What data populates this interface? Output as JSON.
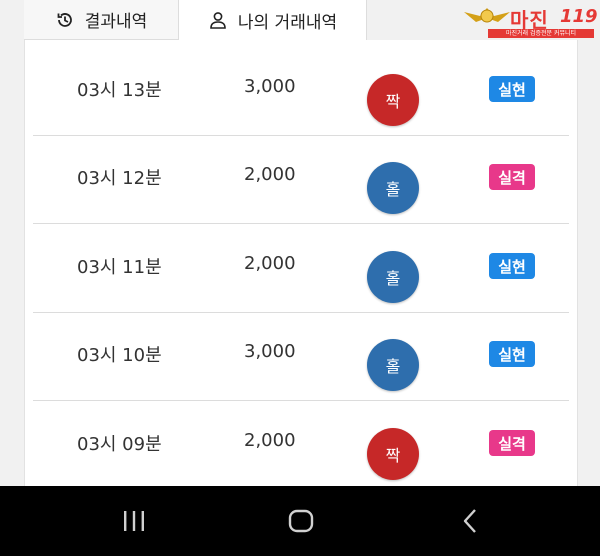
{
  "tabs": [
    {
      "label": "결과내역",
      "icon": "history-icon",
      "active": false
    },
    {
      "label": "나의 거래내역",
      "icon": "user-icon",
      "active": true
    }
  ],
  "logo": {
    "text": "마진",
    "number": "119",
    "subtitle": "마진거래 검증전문 커뮤니티"
  },
  "colors": {
    "even_ball": "#c62828",
    "odd_ball": "#2e6ead",
    "hit_badge": "#1e88e5",
    "miss_badge": "#e8388a"
  },
  "rows": [
    {
      "time": "03시 13분",
      "amount": "3,000",
      "pick": "짝",
      "pick_type": "even",
      "result": "실현",
      "result_type": "hit"
    },
    {
      "time": "03시 12분",
      "amount": "2,000",
      "pick": "홀",
      "pick_type": "odd",
      "result": "실격",
      "result_type": "miss"
    },
    {
      "time": "03시 11분",
      "amount": "2,000",
      "pick": "홀",
      "pick_type": "odd",
      "result": "실현",
      "result_type": "hit"
    },
    {
      "time": "03시 10분",
      "amount": "3,000",
      "pick": "홀",
      "pick_type": "odd",
      "result": "실현",
      "result_type": "hit"
    },
    {
      "time": "03시 09분",
      "amount": "2,000",
      "pick": "짝",
      "pick_type": "even",
      "result": "실격",
      "result_type": "miss"
    }
  ],
  "navbar": {
    "buttons": [
      "recent-apps-icon",
      "home-icon",
      "back-icon"
    ]
  }
}
